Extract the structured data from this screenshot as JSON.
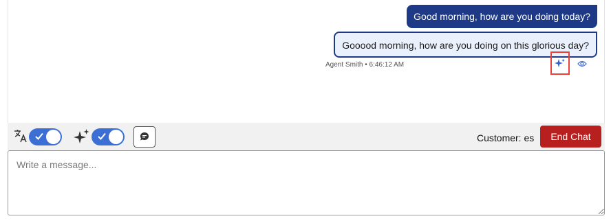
{
  "messages": {
    "sent": "Good morning, how are you doing today?",
    "translated": "Gooood morning, how are you doing on this glorious day?",
    "meta": "Agent Smith • 6:46:12 AM"
  },
  "icons": {
    "translate": "translate-icon",
    "ai_sparkle": "sparkle-icon",
    "comment": "comment-icon",
    "eye": "eye-icon",
    "check": "check-icon"
  },
  "toolbar": {
    "translate_toggle_on": true,
    "ai_toggle_on": true,
    "customer_label": "Customer: es",
    "end_chat_label": "End Chat"
  },
  "composer": {
    "placeholder": "Write a message..."
  },
  "colors": {
    "primary": "#1e3a87",
    "toggle": "#3b6fd6",
    "danger": "#b81f1f",
    "highlight": "#e8413a"
  }
}
